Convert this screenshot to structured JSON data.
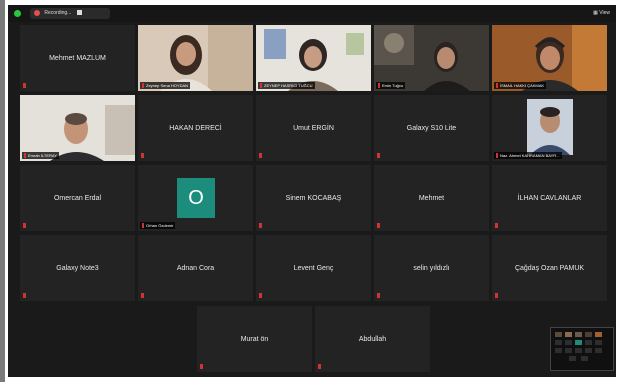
{
  "topbar": {
    "recording_label": "Recording...",
    "view_label": "View",
    "colors": {
      "close": "#ff5f57",
      "min": "#28c840"
    }
  },
  "tiles": [
    {
      "name": "Mehmet MAZLUM",
      "video": false
    },
    {
      "name": "Zeynep Sena HOYDAN",
      "video": true
    },
    {
      "name": "ZEYNEP HASRICI TUĞCU",
      "video": true
    },
    {
      "name": "Emin Tuğcu",
      "video": true
    },
    {
      "name": "İSMAİL HAKKI ÇAKMAK",
      "video": true,
      "active": true
    },
    {
      "name": "Emrah ILTERAY",
      "video": true
    },
    {
      "name": "HAKAN DERECİ",
      "video": false
    },
    {
      "name": "Umut ERGİN",
      "video": false
    },
    {
      "name": "Galaxy S10 Lite",
      "video": false
    },
    {
      "name": "Naz. Ahmet KAHRAMAN BAYR...",
      "video": true
    },
    {
      "name": "Omercan Erdal",
      "video": false
    },
    {
      "name": "Orhan Özdemir",
      "video": false,
      "avatar": "O"
    },
    {
      "name": "Sinem KOCABAŞ",
      "video": false
    },
    {
      "name": "Mehmet",
      "video": false
    },
    {
      "name": "İLHAN CAVLANLAR",
      "video": false
    },
    {
      "name": "Galaxy Note3",
      "video": false
    },
    {
      "name": "Adnan Cora",
      "video": false
    },
    {
      "name": "Levent Genç",
      "video": false
    },
    {
      "name": "selin yıldızlı",
      "video": false
    },
    {
      "name": "Çağdaş Ozan PAMUK",
      "video": false
    },
    {
      "name": "Murat ön",
      "video": false
    },
    {
      "name": "Abdullah",
      "video": false
    }
  ]
}
